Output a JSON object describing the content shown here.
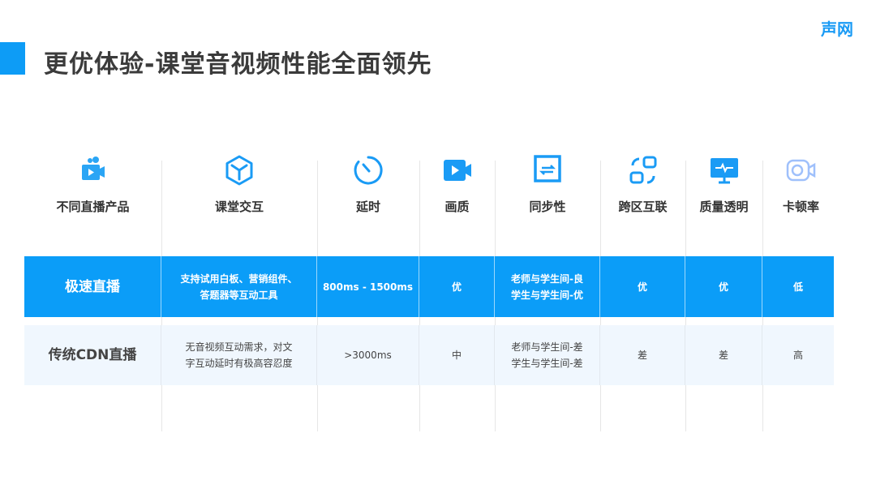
{
  "brand": "声网",
  "title": "更优体验-课堂音视频性能全面领先",
  "colors": {
    "accent": "#0b9df8",
    "row_alt": "#f0f7fe"
  },
  "columns": [
    {
      "label": "不同直播产品",
      "icon": "video-camera-icon"
    },
    {
      "label": "课堂交互",
      "icon": "cube-icon"
    },
    {
      "label": "延时",
      "icon": "timer-icon"
    },
    {
      "label": "画质",
      "icon": "video-icon"
    },
    {
      "label": "同步性",
      "icon": "sync-icon"
    },
    {
      "label": "跨区互联",
      "icon": "cross-region-icon"
    },
    {
      "label": "质量透明",
      "icon": "monitor-pulse-icon"
    },
    {
      "label": "卡顿率",
      "icon": "camera-outline-icon"
    }
  ],
  "rows": [
    {
      "cells": [
        "极速直播",
        "支持试用白板、营销组件、\n答题器等互动工具",
        "800ms - 1500ms",
        "优",
        "老师与学生间-良\n学生与学生间-优",
        "优",
        "优",
        "低"
      ]
    },
    {
      "cells": [
        "传统CDN直播",
        "无音视频互动需求，对文\n字互动延时有极高容忍度",
        ">3000ms",
        "中",
        "老师与学生间-差\n学生与学生间-差",
        "差",
        "差",
        "高"
      ]
    }
  ]
}
